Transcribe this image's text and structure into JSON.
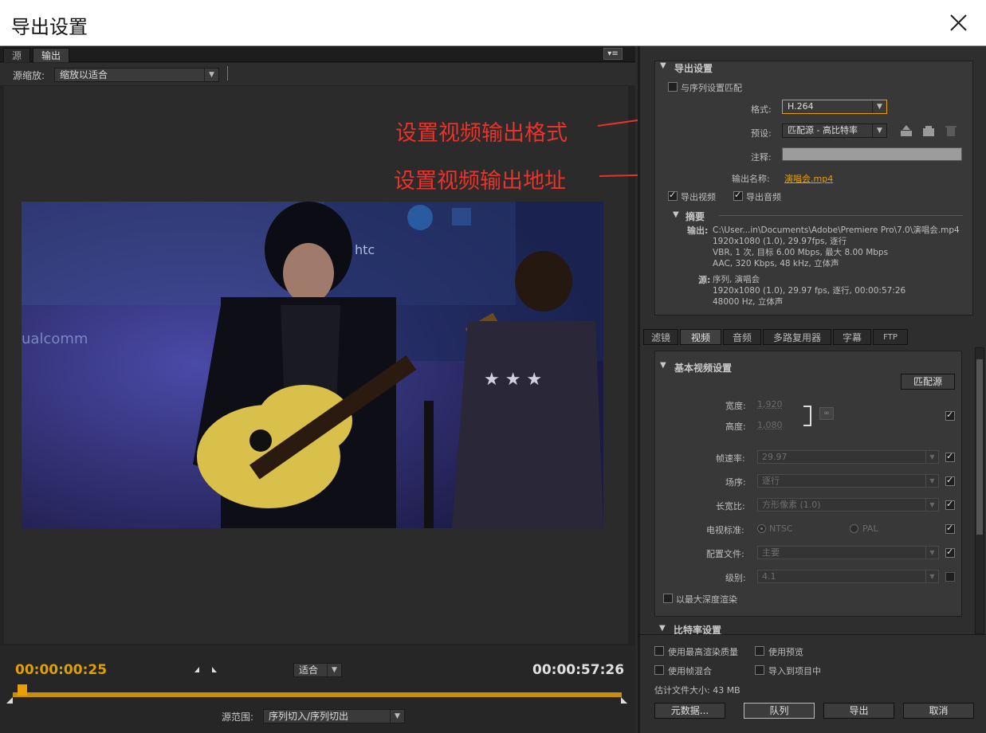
{
  "window": {
    "title": "导出设置"
  },
  "left": {
    "tabs": [
      "源",
      "输出"
    ],
    "source_scale_label": "源缩放:",
    "source_scale_value": "缩放以适合",
    "current_time": "00:00:00:25",
    "duration": "00:00:57:26",
    "fit_value": "适合",
    "range_label": "源范围:",
    "range_value": "序列切入/序列切出"
  },
  "annotations": {
    "format": "设置视频输出格式",
    "output_name": "设置视频输出地址"
  },
  "export_settings": {
    "header": "导出设置",
    "match_sequence": "与序列设置匹配",
    "format_label": "格式:",
    "format_value": "H.264",
    "preset_label": "预设:",
    "preset_value": "匹配源 - 高比特率",
    "comment_label": "注释:",
    "output_name_label": "输出名称:",
    "output_name_value": "演唱会.mp4",
    "export_video": "导出视频",
    "export_audio": "导出音频",
    "summary_header": "摘要",
    "output_label": "输出:",
    "output_lines": [
      "C:\\User...in\\Documents\\Adobe\\Premiere Pro\\7.0\\演唱会.mp4",
      "1920x1080 (1.0), 29.97fps, 逐行",
      "VBR, 1 次, 目标 6.00 Mbps, 最大 8.00 Mbps",
      "AAC, 320 Kbps, 48 kHz, 立体声"
    ],
    "source_label": "源:",
    "source_lines": [
      "序列, 演唱会",
      "1920x1080 (1.0), 29.97 fps, 逐行, 00:00:57:26",
      "48000 Hz, 立体声"
    ]
  },
  "settings_tabs": [
    "滤镜",
    "视频",
    "音频",
    "多路复用器",
    "字幕",
    "FTP"
  ],
  "basic_video": {
    "header": "基本视频设置",
    "match_source_button": "匹配源",
    "width_label": "宽度:",
    "width_value": "1,920",
    "height_label": "高度:",
    "height_value": "1,080",
    "framerate_label": "帧速率:",
    "framerate_value": "29.97",
    "field_label": "场序:",
    "field_value": "逐行",
    "aspect_label": "长宽比:",
    "aspect_value": "方形像素 (1.0)",
    "tv_label": "电视标准:",
    "tv_ntsc": "NTSC",
    "tv_pal": "PAL",
    "profile_label": "配置文件:",
    "profile_value": "主要",
    "level_label": "级别:",
    "level_value": "4.1",
    "max_depth": "以最大深度渲染",
    "bitrate_header": "比特率设置"
  },
  "bottom": {
    "max_render_quality": "使用最高渲染质量",
    "use_preview": "使用预览",
    "frame_blend": "使用帧混合",
    "import_project": "导入到项目中",
    "file_size": "估计文件大小: 43 MB",
    "metadata_button": "元数据...",
    "queue_button": "队列",
    "export_button": "导出",
    "cancel_button": "取消"
  },
  "colors": {
    "accent": "#e8a000",
    "annotation": "#e8322a",
    "timeline": "#c8900a"
  },
  "playhead_fraction": 0.007
}
